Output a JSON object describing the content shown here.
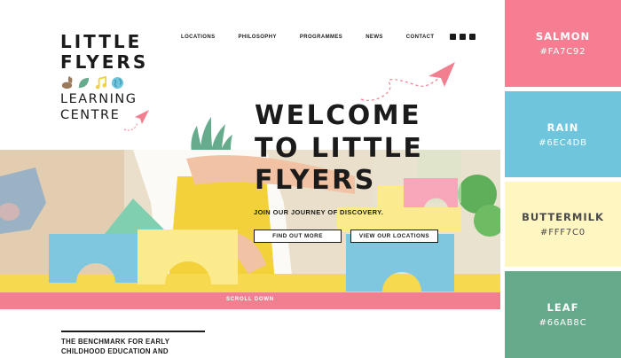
{
  "logo": {
    "line1": "LITTLE",
    "line2": "FLYERS",
    "line3": "LEARNING",
    "line4": "CENTRE"
  },
  "nav": {
    "items": [
      "LOCATIONS",
      "PHILOSOPHY",
      "PROGRAMMES",
      "NEWS",
      "CONTACT"
    ],
    "social_icons": [
      "facebook-icon",
      "instagram-icon",
      "linkedin-icon"
    ]
  },
  "hero": {
    "headline_line1": "WELCOME",
    "headline_line2": "TO LITTLE",
    "headline_line3": "FLYERS",
    "tagline": "JOIN OUR JOURNEY OF DISCOVERY.",
    "button_primary": "FIND OUT MORE",
    "button_secondary": "VIEW OUR LOCATIONS",
    "scroll_label": "SCROLL DOWN"
  },
  "intro": {
    "line1": "THE BENCHMARK FOR EARLY",
    "line2": "CHILDHOOD EDUCATION AND"
  },
  "palette": [
    {
      "name": "SALMON",
      "hex": "#FA7C92",
      "color": "#f77e92",
      "text_color": "#ffffff"
    },
    {
      "name": "RAIN",
      "hex": "#6EC4DB",
      "color": "#6ec5dc",
      "text_color": "#ffffff"
    },
    {
      "name": "BUTTERMILK",
      "hex": "#FFF7C0",
      "color": "#fff6c2",
      "text_color": "#4a4a4a"
    },
    {
      "name": "LEAF",
      "hex": "#66AB8C",
      "color": "#64aa8b",
      "text_color": "#ffffff"
    }
  ]
}
